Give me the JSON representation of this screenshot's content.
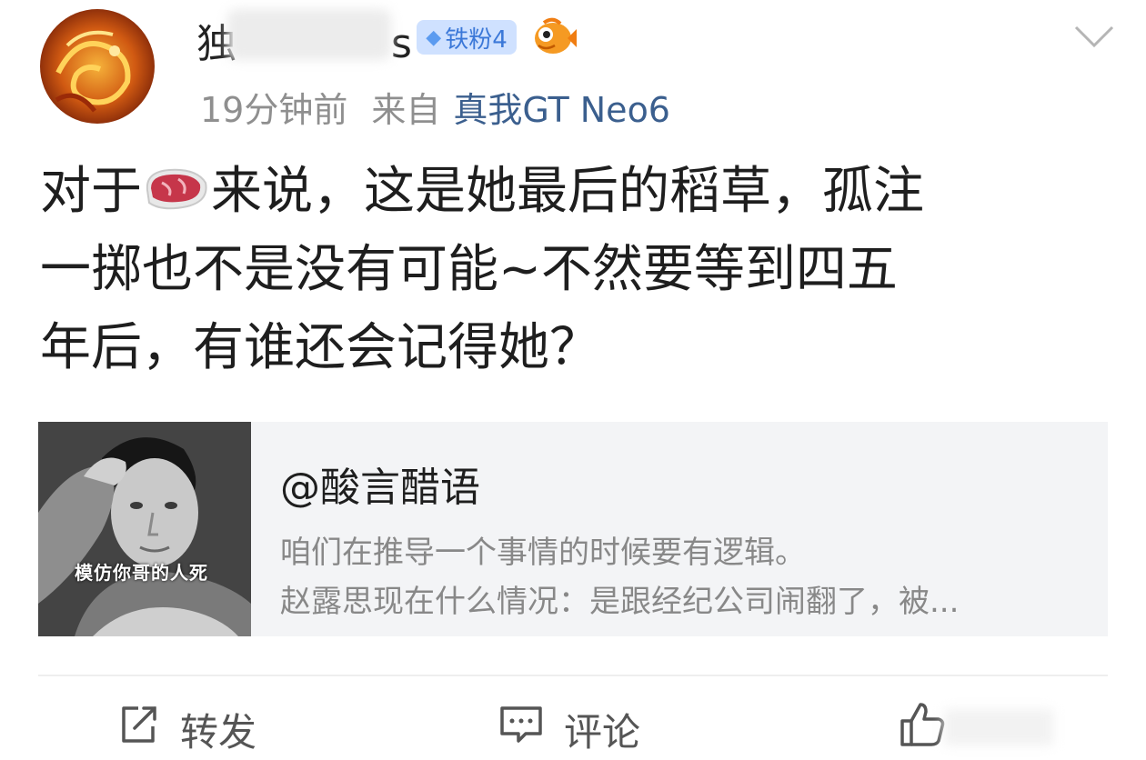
{
  "header": {
    "username_visible": "独",
    "username_tail": "s",
    "badge": {
      "label": "铁粉4",
      "icon": "diamond-icon"
    },
    "mascot_icon": "fish-icon",
    "menu_icon": "chevron-down-icon",
    "time": "19分钟前",
    "from_label": "来自",
    "device": "真我GT Neo6"
  },
  "post": {
    "line1_a": "对于",
    "line1_b": "来说，这是她最后的稻草，孤注",
    "line2": "一掷也不是没有可能~不然要等到四五",
    "line3": "年后，有谁还会记得她？",
    "emoji": "steak-emoji"
  },
  "quoted": {
    "thumbnail_caption": "模仿你哥的人死",
    "title": "@酸言醋语",
    "line1": "咱们在推导一个事情的时候要有逻辑。",
    "line2": "赵露思现在什么情况：是跟经纪公司闹翻了，被..."
  },
  "actions": {
    "repost": "转发",
    "comment": "评论"
  },
  "colors": {
    "link": "#3b5f8e",
    "badge_bg": "#cfe1ff",
    "badge_text": "#3b78d8",
    "meta": "#8f8f8f"
  }
}
